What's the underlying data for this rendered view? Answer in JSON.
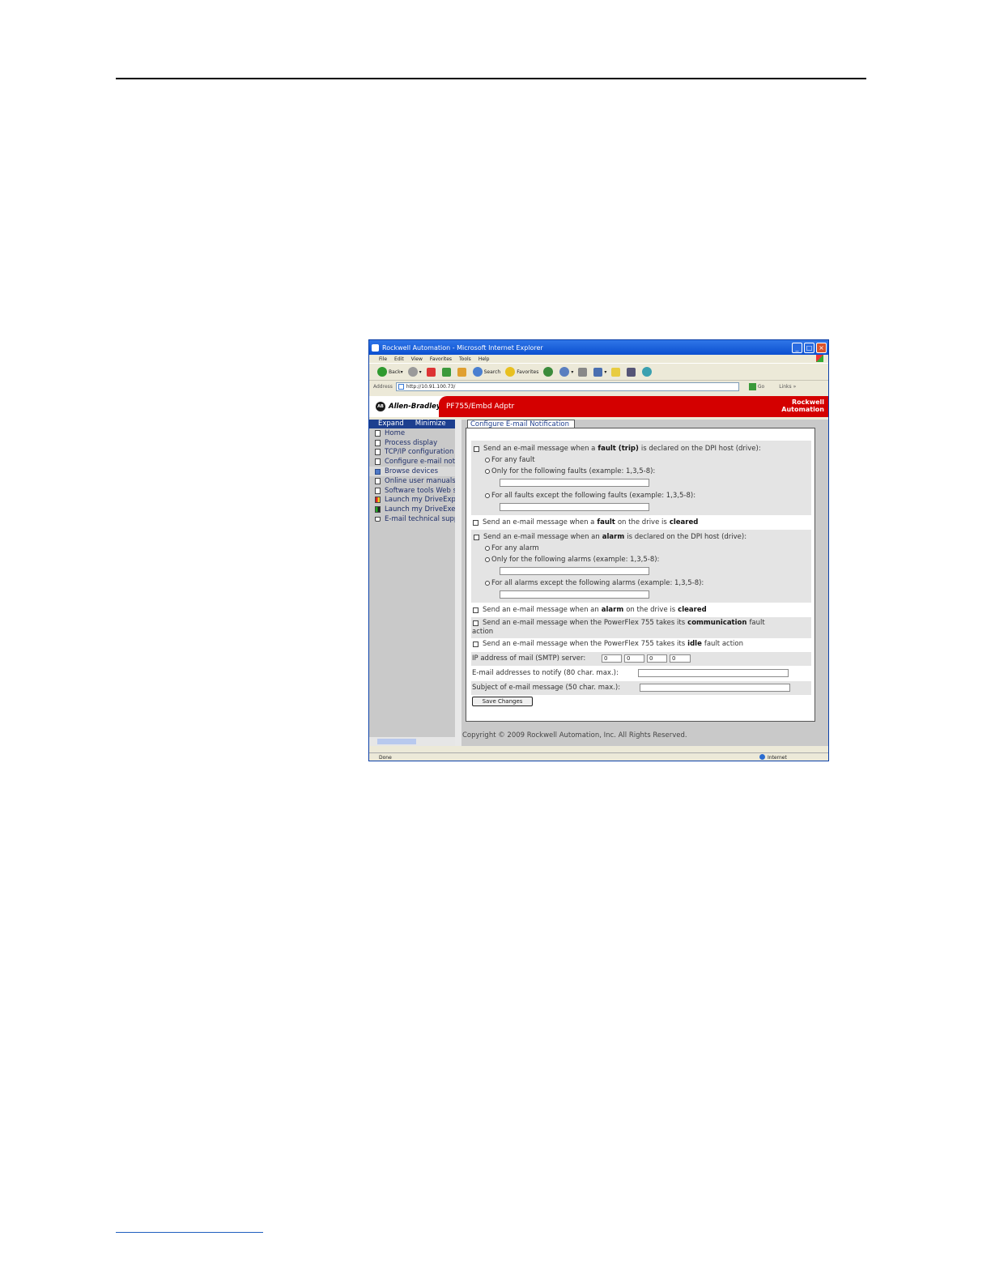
{
  "window": {
    "title": "Rockwell Automation - Microsoft Internet Explorer",
    "menu": [
      "File",
      "Edit",
      "View",
      "Favorites",
      "Tools",
      "Help"
    ],
    "toolbar": {
      "back": "Back",
      "search": "Search",
      "favorites": "Favorites"
    },
    "address": {
      "label": "Address",
      "url": "http://10.91.100.73/",
      "go": "Go",
      "links": "Links"
    },
    "status": {
      "left": "Done",
      "zone": "Internet"
    }
  },
  "header": {
    "brand": "Allen-Bradley",
    "badge": "AB",
    "device": "PF755/Embd Adptr",
    "company_line1": "Rockwell",
    "company_line2": "Automation"
  },
  "nav": {
    "expand": "Expand",
    "minimize": "Minimize",
    "items": [
      {
        "label": "Home"
      },
      {
        "label": "Process display"
      },
      {
        "label": "TCP/IP configuration"
      },
      {
        "label": "Configure e-mail notification"
      },
      {
        "label": "Browse devices"
      },
      {
        "label": "Online user manuals"
      },
      {
        "label": "Software tools Web site"
      },
      {
        "label": "Launch my DriveExplorer"
      },
      {
        "label": "Launch my DriveExecutive"
      },
      {
        "label": "E-mail technical support"
      }
    ]
  },
  "form": {
    "tab": "Configure E-mail Notification",
    "fault": {
      "pre": "Send an e-mail message when a",
      "bold": "fault (trip)",
      "post": "is declared on the DPI host (drive):",
      "opt_any": "For any fault",
      "opt_only": "Only for the following faults (example: 1,3,5-8):",
      "opt_except": "For all faults except the following faults (example: 1,3,5-8):"
    },
    "fault_cleared": {
      "pre": "Send an e-mail message when a",
      "bold": "fault",
      "mid": "on the drive is",
      "bold2": "cleared"
    },
    "alarm": {
      "pre": "Send an e-mail message when an",
      "bold": "alarm",
      "post": "is declared on the DPI host (drive):",
      "opt_any": "For any alarm",
      "opt_only": "Only for the following alarms (example: 1,3,5-8):",
      "opt_except": "For all alarms except the following alarms (example: 1,3,5-8):"
    },
    "alarm_cleared": {
      "pre": "Send an e-mail message when an",
      "bold": "alarm",
      "mid": "on the drive is",
      "bold2": "cleared"
    },
    "comm": {
      "pre": "Send an e-mail message when the PowerFlex 755 takes its",
      "bold": "communication",
      "post": "fault",
      "line2": "action"
    },
    "idle": {
      "pre": "Send an e-mail message when the PowerFlex 755 takes its",
      "bold": "idle",
      "post": "fault action"
    },
    "smtp": {
      "label": "IP address of mail (SMTP) server:",
      "octets": [
        "0",
        "0",
        "0",
        "0"
      ]
    },
    "addresses": {
      "label": "E-mail addresses to notify (80 char. max.):"
    },
    "subject": {
      "label": "Subject of e-mail message (50 char. max.):"
    },
    "save": "Save Changes",
    "copyright": "Copyright © 2009 Rockwell Automation, Inc. All Rights Reserved."
  }
}
